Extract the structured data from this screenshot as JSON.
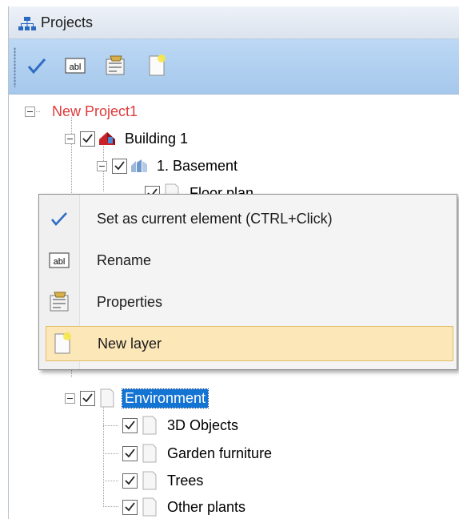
{
  "panel": {
    "title": "Projects"
  },
  "toolbar": {
    "buttons": [
      {
        "icon": "checkmark-icon"
      },
      {
        "icon": "rename-abl-icon"
      },
      {
        "icon": "properties-icon"
      },
      {
        "icon": "new-layer-icon"
      }
    ]
  },
  "tree": {
    "project": "New Project1",
    "building": "Building 1",
    "basement": "1. Basement",
    "floor_plan": "Floor plan",
    "environment": "Environment",
    "env_children": [
      "3D Objects",
      "Garden furniture",
      "Trees",
      "Other plants"
    ]
  },
  "context_menu": {
    "items": [
      {
        "label": "Set as current element (CTRL+Click)",
        "icon": "checkmark-icon"
      },
      {
        "label": "Rename",
        "icon": "rename-abl-icon"
      },
      {
        "label": "Properties",
        "icon": "properties-icon"
      },
      {
        "label": "New layer",
        "icon": "new-layer-icon",
        "highlighted": true
      }
    ]
  },
  "colors": {
    "project_text": "#e03a3a",
    "selection": "#1474d4",
    "menu_highlight": "#fce7b8",
    "toolbar": "#b2d0f0"
  }
}
